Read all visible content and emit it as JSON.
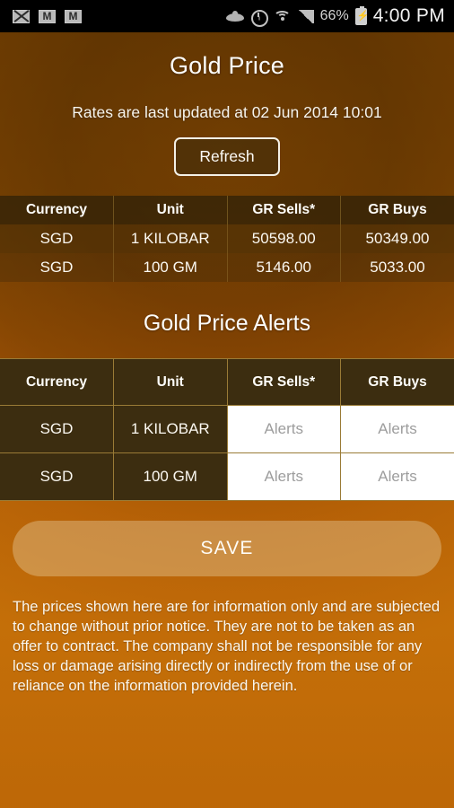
{
  "statusbar": {
    "icons_left": [
      "mail-envelope-icon",
      "gmail-icon",
      "gmail-icon"
    ],
    "icons_right": [
      "eye-icon",
      "alarm-clock-icon",
      "wifi-icon",
      "signal-bars-icon",
      "battery-charging-icon"
    ],
    "battery_percent": "66%",
    "time": "4:00 PM"
  },
  "header": {
    "title": "Gold Price",
    "updated_text": "Rates are last updated at 02 Jun 2014 10:01",
    "refresh_label": "Refresh"
  },
  "rates_table": {
    "columns": [
      "Currency",
      "Unit",
      "GR Sells*",
      "GR Buys"
    ],
    "rows": [
      {
        "currency": "SGD",
        "unit": "1 KILOBAR",
        "sells": "50598.00",
        "buys": "50349.00"
      },
      {
        "currency": "SGD",
        "unit": "100 GM",
        "sells": "5146.00",
        "buys": "5033.00"
      }
    ]
  },
  "alerts": {
    "title": "Gold Price Alerts",
    "columns": [
      "Currency",
      "Unit",
      "GR Sells*",
      "GR Buys"
    ],
    "rows": [
      {
        "currency": "SGD",
        "unit": "1 KILOBAR",
        "sells_value": "",
        "sells_placeholder": "Alerts",
        "buys_value": "",
        "buys_placeholder": "Alerts"
      },
      {
        "currency": "SGD",
        "unit": "100 GM",
        "sells_value": "",
        "sells_placeholder": "Alerts",
        "buys_value": "",
        "buys_placeholder": "Alerts"
      }
    ]
  },
  "save_label": "SAVE",
  "disclaimer": "The prices shown here are for information only and are subjected to change without prior notice. They are not to be taken as an offer to contract. The company shall not be responsible for any loss or damage arising directly or indirectly from the use of or reliance on the information provided herein.",
  "colors": {
    "background_top": "#6e5210",
    "background_bottom": "#a87523",
    "table_header": "#3c2d10",
    "table_border": "#9a7b36",
    "text": "#fbf8f1",
    "alert_field": "#ffffff",
    "placeholder": "#9d9d9d",
    "status_bar": "#000000"
  }
}
